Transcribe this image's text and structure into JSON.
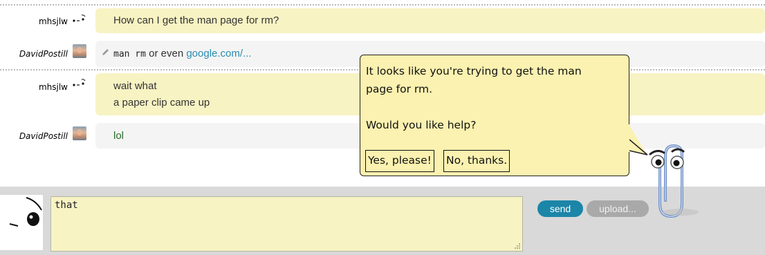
{
  "messages": [
    {
      "user": "mhsjlw",
      "text": "How can I get the man page for rm?"
    },
    {
      "user": "DavidPostill",
      "code": "man rm",
      "mid": " or even ",
      "link": "google.com/..."
    },
    {
      "user": "mhsjlw",
      "lines": [
        "wait what",
        "a paper clip came up"
      ]
    },
    {
      "user": "DavidPostill",
      "text": "lol"
    }
  ],
  "composer": {
    "value": "that",
    "send_label": "send",
    "upload_label": "upload..."
  },
  "clippy": {
    "line1": "It looks like you're trying to get the man",
    "line2": "page for rm.",
    "line3": "Would you like help?",
    "yes_label": "Yes, please!",
    "no_label": "No, thanks."
  },
  "colors": {
    "message_yellow": "#f8f3c3",
    "message_gray": "#f4f4f4",
    "send_blue": "#1b86a8",
    "link": "#2a8bb0",
    "bubble": "#fbf1b0"
  }
}
